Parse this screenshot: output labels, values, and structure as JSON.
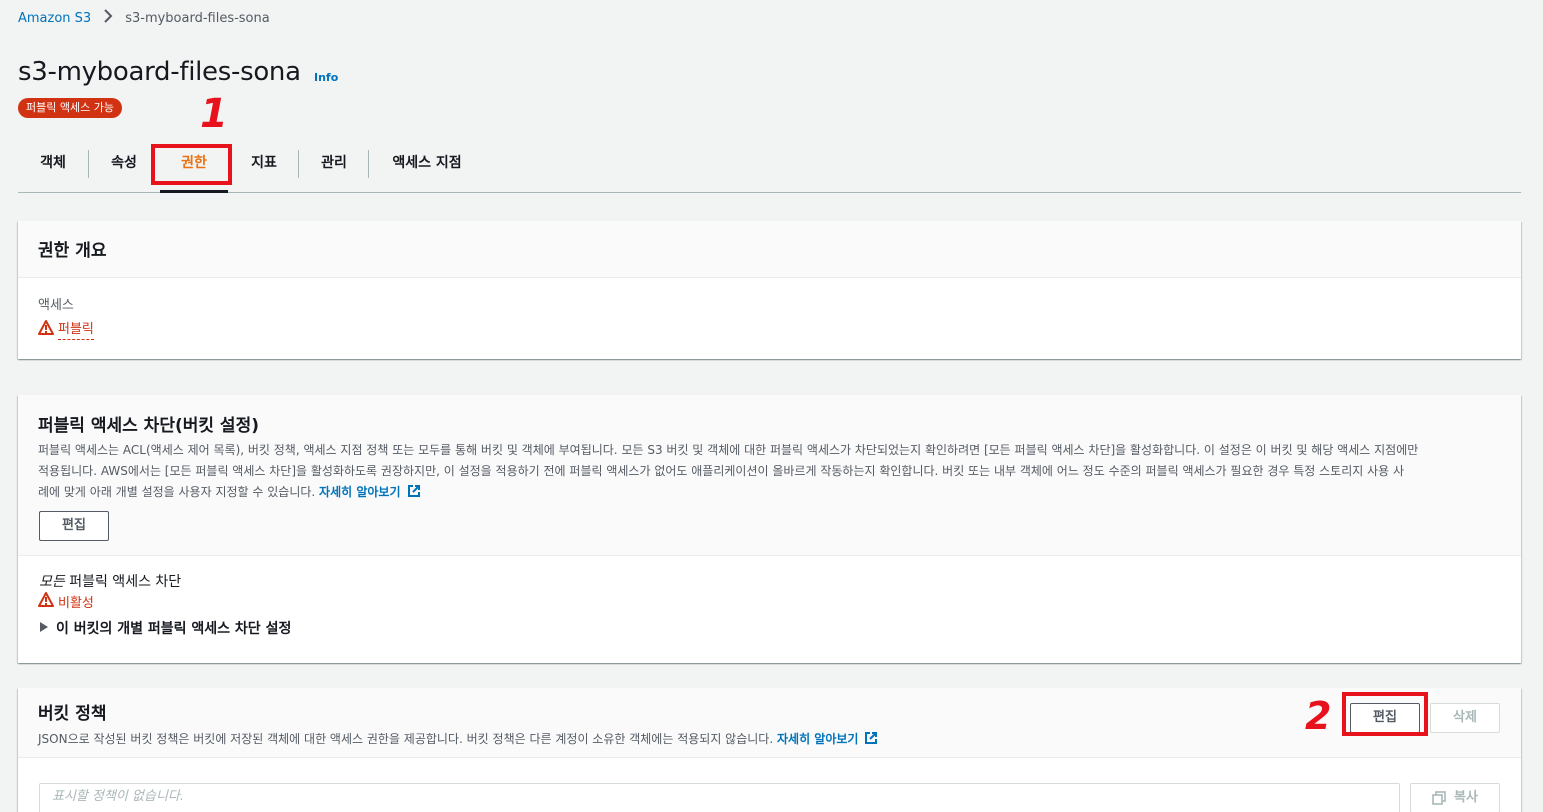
{
  "breadcrumb": {
    "root": "Amazon S3",
    "current": "s3-myboard-files-sona"
  },
  "header": {
    "title": "s3-myboard-files-sona",
    "info_link": "Info",
    "badge": "퍼블릭 액세스 가능"
  },
  "tabs": [
    "객체",
    "속성",
    "권한",
    "지표",
    "관리",
    "액세스 지점"
  ],
  "active_tab": "권한",
  "overview": {
    "title": "권한 개요",
    "access_label": "액세스",
    "access_value": "퍼블릭"
  },
  "block_public": {
    "title": "퍼블릭 액세스 차단(버킷 설정)",
    "desc_line1": "퍼블릭 액세스는 ACL(액세스 제어 목록), 버킷 정책, 액세스 지점 정책 또는 모두를 통해 버킷 및 객체에 부여됩니다. 모든 S3 버킷 및 객체에 대한 퍼블릭 액세스가 차단되었는지 확인하려면 [모든 퍼블릭 액세스 차단]을 활성화합니다. 이 설정은 이 버킷 및 해당 액세스 지점에만",
    "desc_line2": "적용됩니다. AWS에서는 [모든 퍼블릭 액세스 차단]을 활성화하도록 권장하지만, 이 설정을 적용하기 전에 퍼블릭 액세스가 없어도 애플리케이션이 올바르게 작동하는지 확인합니다. 버킷 또는 내부 객체에 어느 정도 수준의 퍼블릭 액세스가 필요한 경우 특정 스토리지 사용 사",
    "desc_line3": "례에 맞게 아래 개별 설정을 사용자 지정할 수 있습니다.",
    "learn_more": "자세히 알아보기",
    "edit_button": "편집",
    "all_block_label_italic": "모든",
    "all_block_label_rest": "퍼블릭 액세스 차단",
    "status": "비활성",
    "expand_label": "이 버킷의 개별 퍼블릭 액세스 차단 설정"
  },
  "bucket_policy": {
    "title": "버킷 정책",
    "desc": "JSON으로 작성된 버킷 정책은 버킷에 저장된 객체에 대한 액세스 권한을 제공합니다. 버킷 정책은 다른 계정이 소유한 객체에는 적용되지 않습니다.",
    "learn_more": "자세히 알아보기",
    "edit_button": "편집",
    "delete_button": "삭제",
    "placeholder": "표시할 정책이 없습니다.",
    "copy_button": "복사"
  },
  "annotations": {
    "mark1": "1",
    "mark2": "2"
  },
  "colors": {
    "accent": "#0073bb",
    "active_tab": "#ec7211",
    "danger": "#d13212",
    "annotation": "#e8121d"
  },
  "icons": [
    "chevron-right-icon",
    "warning-icon",
    "external-link-icon",
    "caret-right-icon",
    "copy-icon"
  ]
}
